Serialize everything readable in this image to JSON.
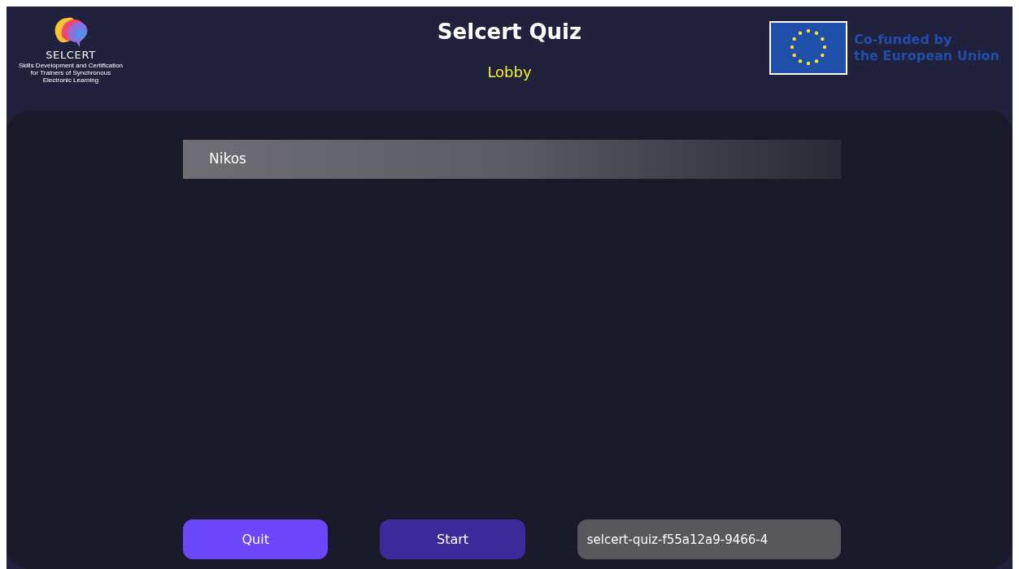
{
  "header": {
    "logo": {
      "name": "SELCERT",
      "tagline": [
        "Skills Development and Certification",
        "for Trainers of Synchronous",
        "Electronic Learning"
      ]
    },
    "title": "Selcert Quiz",
    "subtitle": "Lobby",
    "funding": [
      "Co-funded by",
      "the European Union"
    ]
  },
  "players": [
    {
      "name": "Nikos"
    }
  ],
  "buttons": [
    {
      "label": "Quit",
      "kind": "primary"
    },
    {
      "label": "Start",
      "kind": "secondary"
    }
  ],
  "room_code": {
    "value": "selcert-quiz-f55a12a9-9466-4"
  }
}
